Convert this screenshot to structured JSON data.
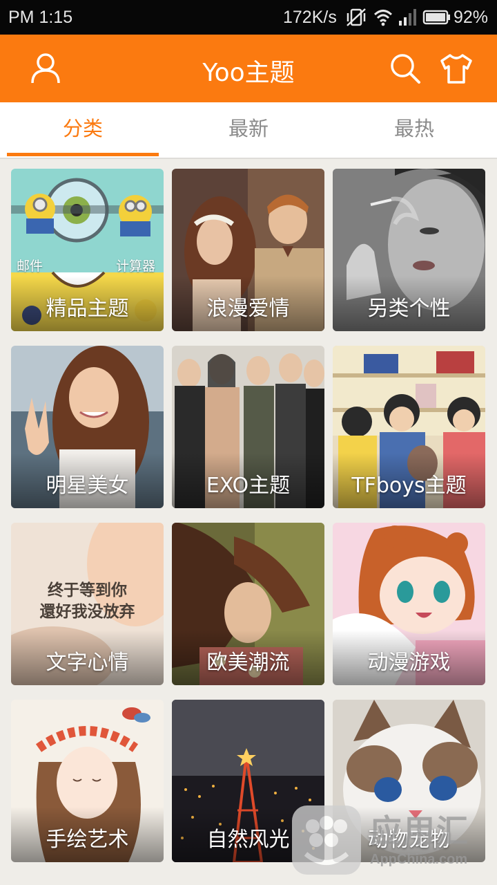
{
  "status_bar": {
    "time": "PM 1:15",
    "net_speed": "172K/s",
    "battery_percent": "92%",
    "icons": [
      "mute-vibrate-icon",
      "wifi-icon",
      "signal-icon",
      "battery-icon"
    ]
  },
  "app_bar": {
    "title": "Yoo主题",
    "background_color": "#fb7a10",
    "icons": [
      "user-profile-icon",
      "search-icon",
      "tshirt-theme-icon"
    ]
  },
  "tabs": [
    {
      "label": "分类",
      "active": true
    },
    {
      "label": "最新",
      "active": false
    },
    {
      "label": "最热",
      "active": false
    }
  ],
  "categories": [
    {
      "label": "精品主题",
      "sub_left": "邮件",
      "sub_right": "计算器"
    },
    {
      "label": "浪漫爱情"
    },
    {
      "label": "另类个性"
    },
    {
      "label": "明星美女"
    },
    {
      "label": "EXO主题"
    },
    {
      "label": "TFboys主题"
    },
    {
      "label": "文字心情",
      "quote_line1": "终于等到你",
      "quote_line2": "還好我没放弃"
    },
    {
      "label": "欧美潮流"
    },
    {
      "label": "动漫游戏"
    },
    {
      "label": "手绘艺术"
    },
    {
      "label": "自然风光"
    },
    {
      "label": "动物宠物"
    }
  ],
  "watermark": {
    "text_cn": "应用汇",
    "text_en": "AppChina.com"
  }
}
